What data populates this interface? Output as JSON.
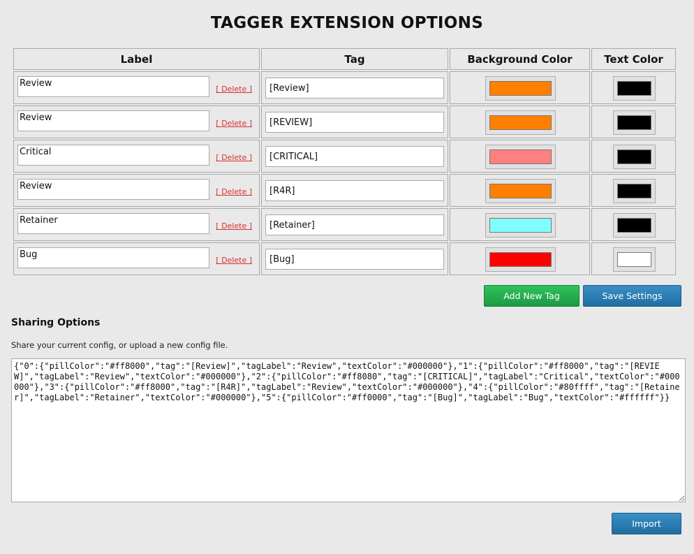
{
  "page": {
    "title": "TAGGER EXTENSION OPTIONS"
  },
  "table": {
    "headers": {
      "label": "Label",
      "tag": "Tag",
      "background_color": "Background Color",
      "text_color": "Text Color"
    },
    "delete_label": "[ Delete ]",
    "rows": [
      {
        "label": "Review",
        "tag": "[Review]",
        "background_color": "#ff8000",
        "text_color": "#000000"
      },
      {
        "label": "Review",
        "tag": "[REVIEW]",
        "background_color": "#ff8000",
        "text_color": "#000000"
      },
      {
        "label": "Critical",
        "tag": "[CRITICAL]",
        "background_color": "#ff8080",
        "text_color": "#000000"
      },
      {
        "label": "Review",
        "tag": "[R4R]",
        "background_color": "#ff8000",
        "text_color": "#000000"
      },
      {
        "label": "Retainer",
        "tag": "[Retainer]",
        "background_color": "#80ffff",
        "text_color": "#000000"
      },
      {
        "label": "Bug",
        "tag": "[Bug]",
        "background_color": "#ff0000",
        "text_color": "#ffffff"
      }
    ]
  },
  "actions": {
    "add_new_tag": "Add New Tag",
    "save_settings": "Save Settings"
  },
  "sharing": {
    "heading": "Sharing Options",
    "description": "Share your current config, or upload a new config file.",
    "config_text": "{\"0\":{\"pillColor\":\"#ff8000\",\"tag\":\"[Review]\",\"tagLabel\":\"Review\",\"textColor\":\"#000000\"},\"1\":{\"pillColor\":\"#ff8000\",\"tag\":\"[REVIEW]\",\"tagLabel\":\"Review\",\"textColor\":\"#000000\"},\"2\":{\"pillColor\":\"#ff8080\",\"tag\":\"[CRITICAL]\",\"tagLabel\":\"Critical\",\"textColor\":\"#000000\"},\"3\":{\"pillColor\":\"#ff8000\",\"tag\":\"[R4R]\",\"tagLabel\":\"Review\",\"textColor\":\"#000000\"},\"4\":{\"pillColor\":\"#80ffff\",\"tag\":\"[Retainer]\",\"tagLabel\":\"Retainer\",\"textColor\":\"#000000\"},\"5\":{\"pillColor\":\"#ff0000\",\"tag\":\"[Bug]\",\"tagLabel\":\"Bug\",\"textColor\":\"#ffffff\"}}",
    "import_label": "Import"
  }
}
